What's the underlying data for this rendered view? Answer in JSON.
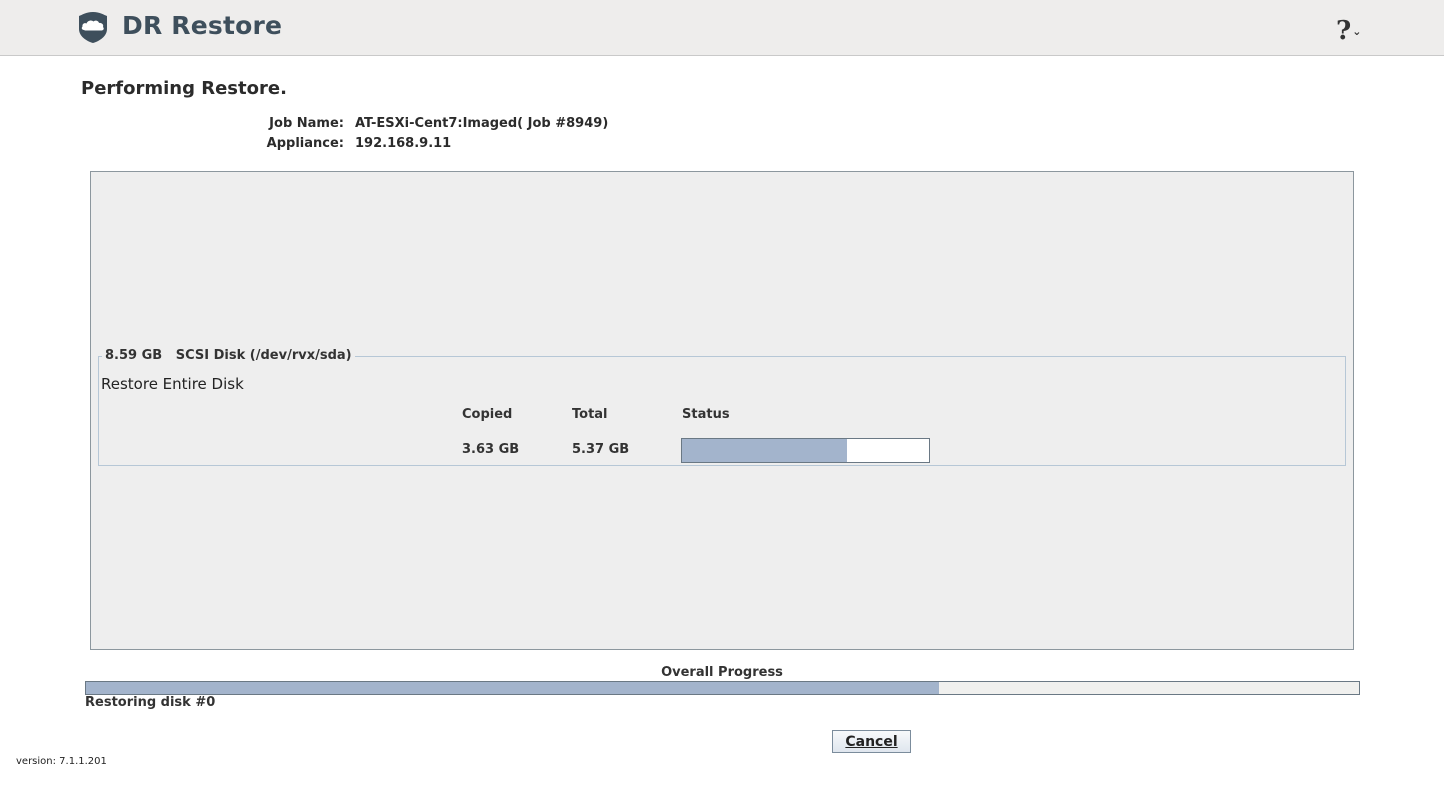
{
  "header": {
    "app_title": "DR Restore",
    "help_label": "?",
    "help_caret": "⌄"
  },
  "page_title": "Performing Restore.",
  "job": {
    "name_label": "Job Name:",
    "name_value": "AT-ESXi-Cent7:Imaged(  Job #8949)",
    "appliance_label": "Appliance:",
    "appliance_value": "192.168.9.11"
  },
  "disk": {
    "legend": "8.59 GB   SCSI Disk (/dev/rvx/sda)",
    "restore_label": "Restore Entire Disk",
    "col_copied": "Copied",
    "col_total": "Total",
    "col_status": "Status",
    "copied": "3.63 GB",
    "total": "5.37 GB",
    "progress_fraction": 0.67
  },
  "overall": {
    "label": "Overall Progress",
    "progress_fraction": 0.67,
    "status_text": "Restoring disk #0"
  },
  "cancel_label": "Cancel",
  "version": "version: 7.1.1.201",
  "colors": {
    "progress_fill": "#a3b4cc",
    "title_color": "#3e4f5c"
  }
}
